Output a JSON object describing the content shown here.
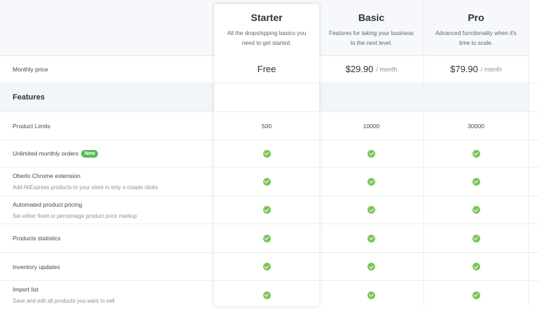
{
  "plans": [
    {
      "name": "Starter",
      "description": "All the dropshipping basics you need to get started.",
      "price": "Free",
      "unit": ""
    },
    {
      "name": "Basic",
      "description": "Features for taking your business to the next level.",
      "price": "$29.90",
      "unit": "/ month"
    },
    {
      "name": "Pro",
      "description": "Advanced functionality when it's time to scale.",
      "price": "$79.90",
      "unit": "/ month"
    }
  ],
  "monthly_price_label": "Monthly price",
  "features_heading": "Features",
  "features": [
    {
      "label": "Product Limits",
      "values": [
        "500",
        "10000",
        "30000"
      ]
    },
    {
      "label": "Unlimited monthly orders",
      "badge": "New",
      "values": [
        "check",
        "check",
        "check"
      ]
    },
    {
      "label": "Oberlo Chrome extension",
      "sublabel": "Add AliExpress products to your store in only a couple clicks",
      "values": [
        "check",
        "check",
        "check"
      ]
    },
    {
      "label": "Automated product pricing",
      "sublabel": "Set either fixed or percentage product price markup",
      "values": [
        "check",
        "check",
        "check"
      ]
    },
    {
      "label": "Products statistics",
      "values": [
        "check",
        "check",
        "check"
      ]
    },
    {
      "label": "Inventory updates",
      "values": [
        "check",
        "check",
        "check"
      ]
    },
    {
      "label": "Import list",
      "sublabel": "Save and edit all products you want to sell",
      "values": [
        "check",
        "check",
        "check"
      ]
    }
  ],
  "colors": {
    "check": "#7cc45a",
    "badge": "#5cb85c",
    "header_bg": "#f6f8fb"
  }
}
